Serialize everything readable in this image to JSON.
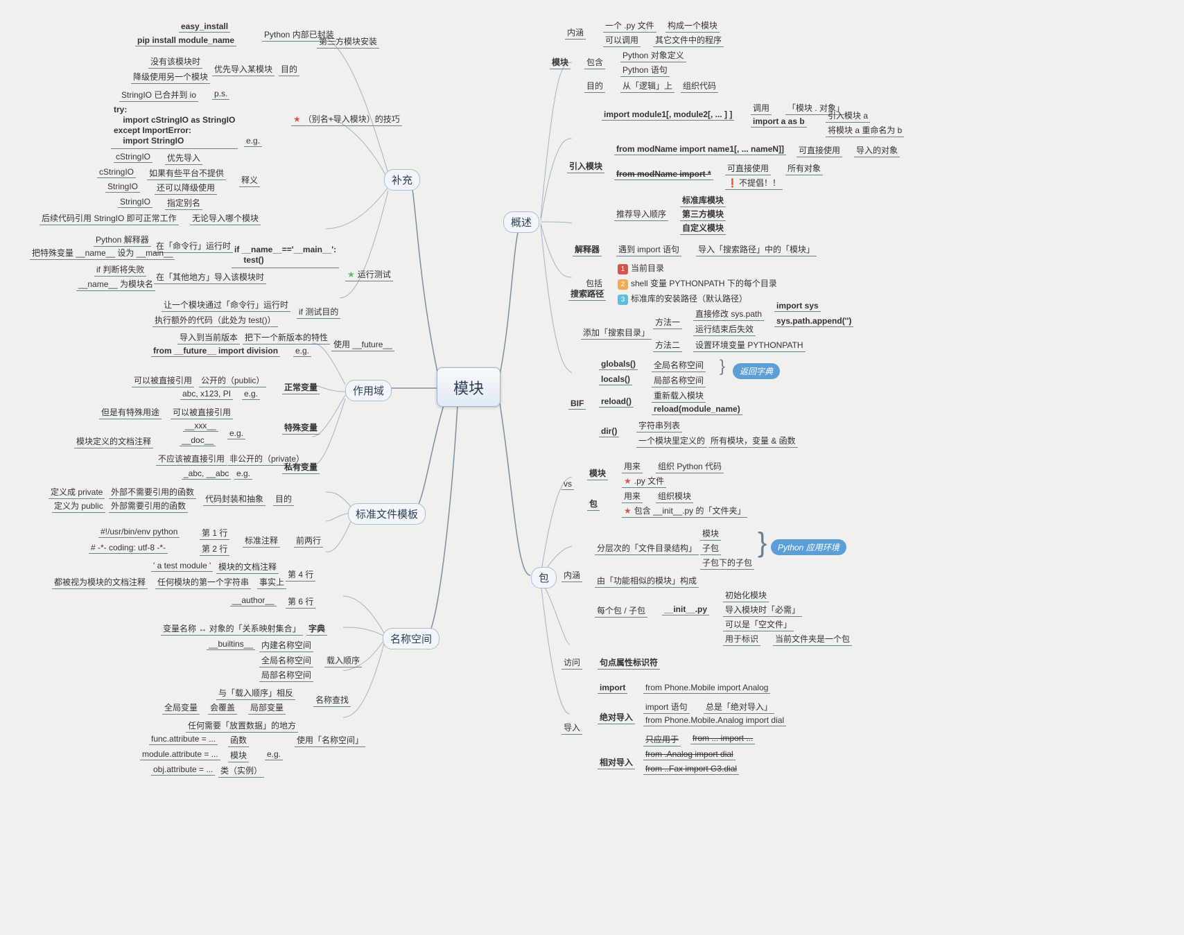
{
  "central": "模块",
  "branches": {
    "supplement": "补充",
    "overview": "概述",
    "scope": "作用域",
    "template": "标准文件模板",
    "namespace": "名称空间",
    "package": "包"
  },
  "nodes": {
    "n1": "easy_install",
    "n2": "pip install module_name",
    "n3": "Python 内部已封装",
    "n4": "第三方模块安装",
    "n5": "没有该模块时",
    "n6": "降级使用另一个模块",
    "n7": "优先导入某模块",
    "n8": "目的",
    "n9": "StringIO 已合并到 io",
    "n10": "p.s.",
    "n11": "try:\n    import cStringIO as StringIO\nexcept ImportError:\n    import StringIO",
    "n12": "e.g.",
    "n13": "（别名+导入模块）的技巧",
    "n14": "cStringIO",
    "n15": "优先导入",
    "n16": "cStringIO",
    "n17": "如果有些平台不提供",
    "n18": "StringIO",
    "n19": "还可以降级使用",
    "n20": "释义",
    "n21": "StringIO",
    "n22": "指定别名",
    "n23": "后续代码引用 StringIO 即可正常工作",
    "n24": "无论导入哪个模块",
    "n25": "Python 解释器",
    "n26": "在「命令行」运行时",
    "n27": "把特殊变量 __name__ 设为 __main__",
    "n28": "if 判断将失败",
    "n29": "在「其他地方」导入该模块时",
    "n30": "__name__ 为模块名",
    "n31": "if __name__=='__main__':\n    test()",
    "n32": "运行测试",
    "n33": "让一个模块通过「命令行」运行时",
    "n34": "if 测试目的",
    "n35": "执行额外的代码（此处为 test()）",
    "n36": "导入到当前版本",
    "n37": "把下一个新版本的特性",
    "n38": "使用 __future__",
    "n39": "from __future__ import division",
    "n40": "e.g.",
    "n41": "可以被直接引用",
    "n42": "公开的（public）",
    "n43": "正常变量",
    "n44": "abc, x123, PI",
    "n45": "e.g.",
    "n46": "但是有特殊用途",
    "n47": "可以被直接引用",
    "n48": "特殊变量",
    "n49": "__xxx__",
    "n50": "e.g.",
    "n51": "模块定义的文档注释",
    "n52": "__doc__",
    "n53": "不应该被直接引用",
    "n54": "非公开的（private）",
    "n55": "私有变量",
    "n56": "_abc, __abc",
    "n57": "e.g.",
    "n58": "定义成 private",
    "n59": "外部不需要引用的函数",
    "n60": "代码封装和抽象",
    "n61": "目的",
    "n62": "定义为 public",
    "n63": "外部需要引用的函数",
    "n64": "#!/usr/bin/env python",
    "n65": "第 1 行",
    "n66": "标准注释",
    "n67": "前两行",
    "n68": "# -*- coding: utf-8 -*-",
    "n69": "第 2 行",
    "n70": "' a test module '",
    "n71": "模块的文档注释",
    "n72": "第 4 行",
    "n73": "都被视为模块的文档注释",
    "n74": "任何模块的第一个字符串",
    "n75": "事实上",
    "n76": "__author__",
    "n77": "第 6 行",
    "n78": "变量名称 ↔ 对象的「关系映射集合」",
    "n79": "字典",
    "n80": "__builtins__",
    "n81": "内建名称空间",
    "n82": "载入顺序",
    "n83": "全局名称空间",
    "n84": "局部名称空间",
    "n85": "与「载入顺序」相反",
    "n86": "名称查找",
    "n87": "全局变量",
    "n88": "会覆盖",
    "n89": "局部变量",
    "n90": "任何需要「放置数据」的地方",
    "n91": "使用「名称空间」",
    "n92": "func.attribute = ...",
    "n93": "函数",
    "n94": "module.attribute = ...",
    "n95": "模块",
    "n96": "e.g.",
    "n97": "obj.attribute = ...",
    "n98": "类（实例）",
    "n99": "内涵",
    "n100": "一个 .py 文件",
    "n101": "构成一个模块",
    "n102": "可以调用",
    "n103": "其它文件中的程序",
    "n104": "模块",
    "n105": "包含",
    "n106": "Python 对象定义",
    "n107": "Python 语句",
    "n108": "目的",
    "n109": "从「逻辑」上",
    "n110": "组织代码",
    "n111": "调用",
    "n112": "「模块 . 对象」",
    "n113": "import module1[, module2[, ... ] ]",
    "n114": "import a as b",
    "n115": "引入模块 a",
    "n116": "将模块 a 重命名为 b",
    "n117": "引入模块",
    "n118": "from modName import name1[, ... nameN]]",
    "n119": "可直接使用",
    "n120": "导入的对象",
    "n121": "from modName import *",
    "n122": "可直接使用",
    "n123": "所有对象",
    "n124": "不提倡！！",
    "n125": "推荐导入顺序",
    "n126": "标准库模块",
    "n127": "第三方模块",
    "n128": "自定义模块",
    "n129": "解释器",
    "n130": "遇到 import 语句",
    "n131": "导入「搜索路径」中的「模块」",
    "n132": "当前目录",
    "n133": "shell 变量 PYTHONPATH 下的每个目录",
    "n134": "标准库的安装路径（默认路径）",
    "n135": "搜索路径",
    "n136": "包括",
    "n137": "方法一",
    "n138": "直接修改 sys.path",
    "n139": "import sys",
    "n140": "sys.path.append('')",
    "n141": "运行结束后失效",
    "n142": "方法二",
    "n143": "设置环境变量 PYTHONPATH",
    "n144": "添加「搜索目录」",
    "n145": "globals()",
    "n146": "全局名称空间",
    "n147": "locals()",
    "n148": "局部名称空间",
    "n149": "返回字典",
    "n150": "BIF",
    "n151": "reload()",
    "n152": "重新载入模块",
    "n153": "reload(module_name)",
    "n154": "dir()",
    "n155": "字符串列表",
    "n156": "一个模块里定义的",
    "n157": "所有模块，变量 & 函数",
    "n158": "vs",
    "n159": "模块",
    "n160": "用来",
    "n161": "组织 Python 代码",
    "n162": ".py 文件",
    "n163": "包",
    "n164": "用来",
    "n165": "组织模块",
    "n166": "包含 __init__.py 的「文件夹」",
    "n167": "模块",
    "n168": "分层次的「文件目录结构」",
    "n169": "子包",
    "n170": "子包下的子包",
    "n171": "Python 应用环境",
    "n172": "内涵",
    "n173": "由「功能相似的模块」构成",
    "n174": "每个包 / 子包",
    "n175": "__init__.py",
    "n176": "初始化模块",
    "n177": "导入模块时「必需」",
    "n178": "可以是「空文件」",
    "n179": "用于标识",
    "n180": "当前文件夹是一个包",
    "n181": "访问",
    "n182": "句点属性标识符",
    "n183": "import",
    "n184": "from Phone.Mobile import Analog",
    "n185": "绝对导入",
    "n186": "import 语句",
    "n187": "总是「绝对导入」",
    "n188": "from Phone.Mobile.Analog import dial",
    "n189": "只应用于",
    "n190": "from ... import ...",
    "n191": "相对导入",
    "n192": "from .Analog import dial",
    "n193": "from ..Fax import G3.dial",
    "n194": "导入"
  }
}
